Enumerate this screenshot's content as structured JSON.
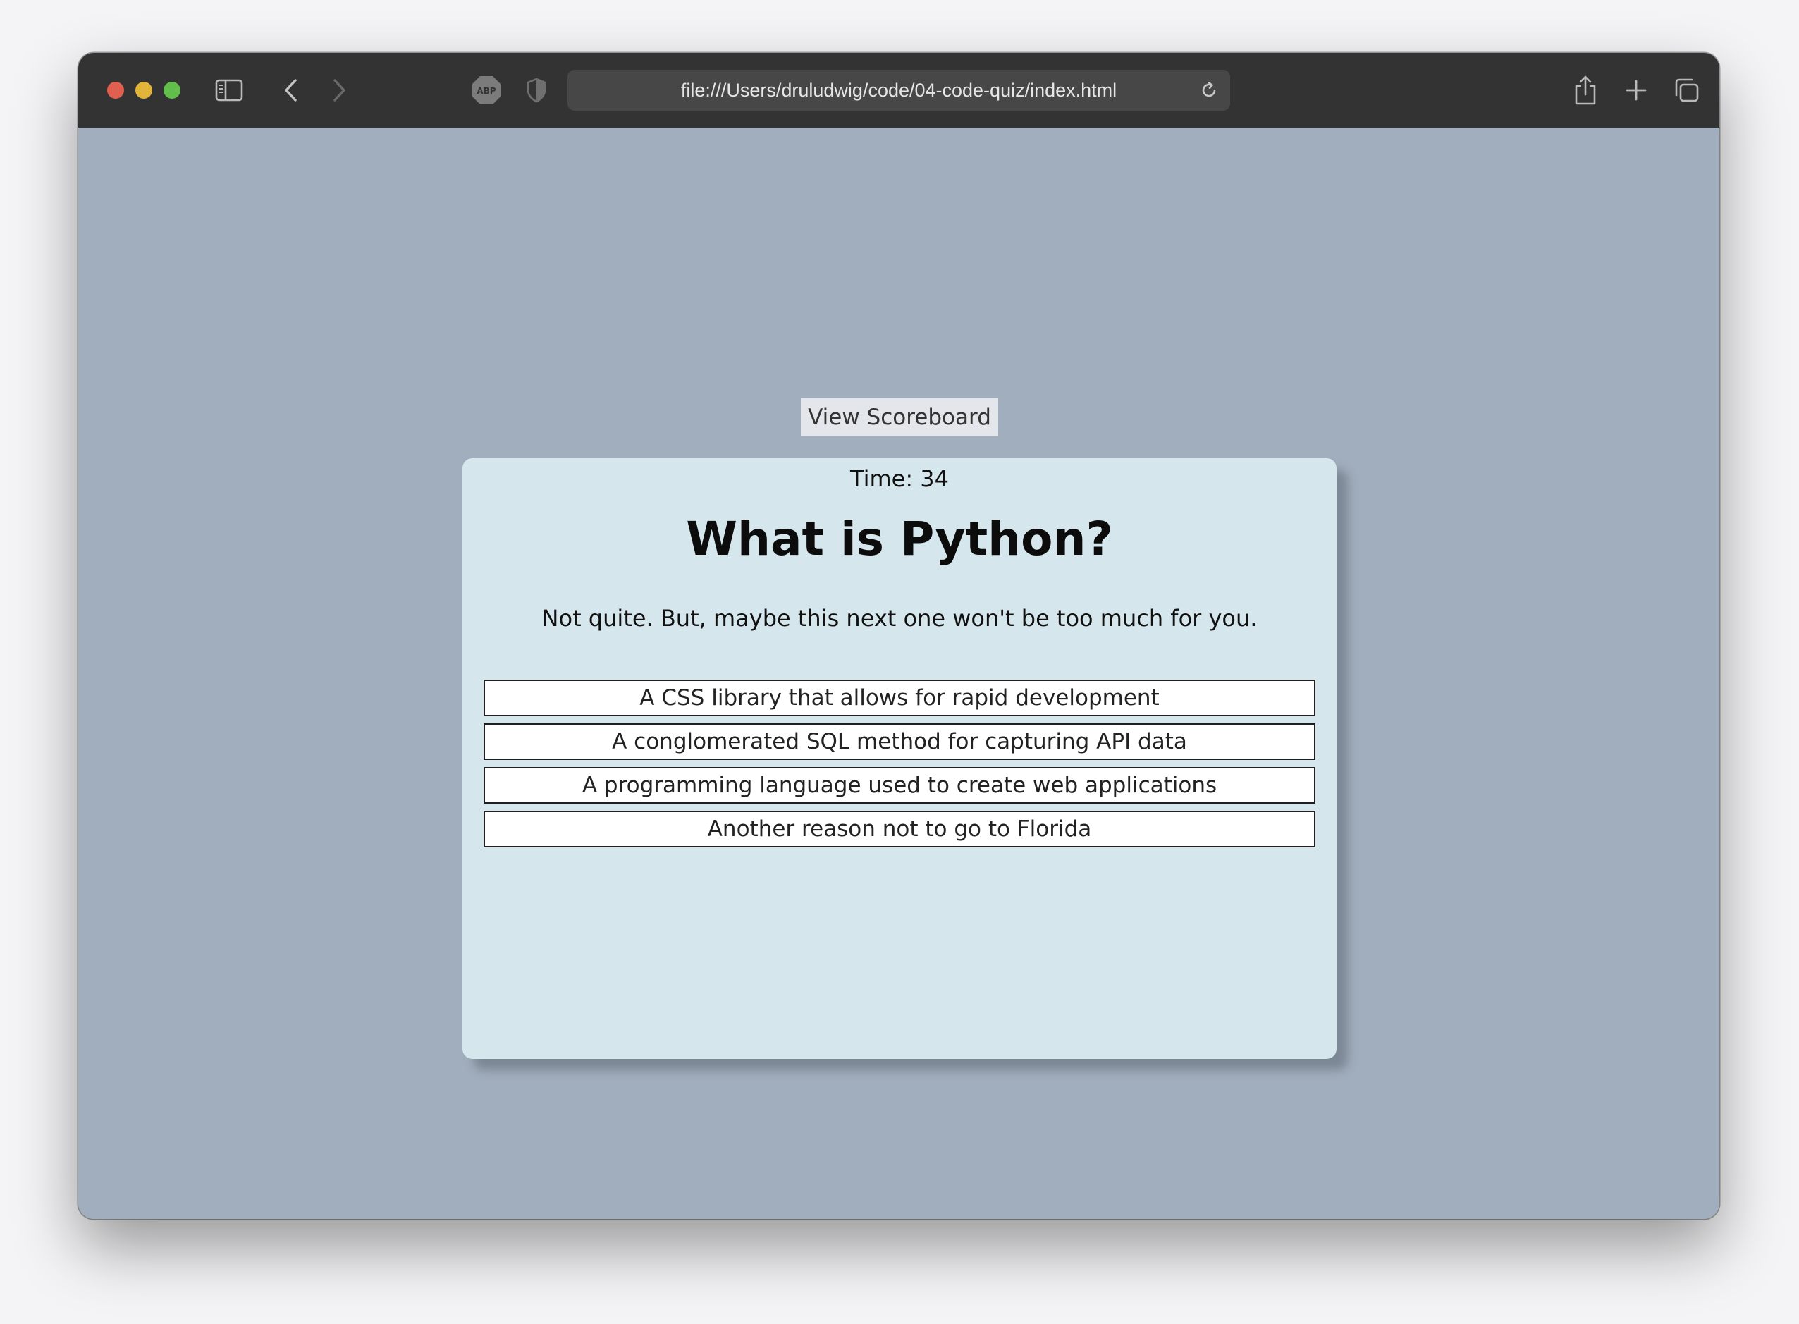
{
  "browser": {
    "url": "file:///Users/druludwig/code/04-code-quiz/index.html",
    "abp_label": "ABP"
  },
  "page": {
    "scoreboard_label": "View Scoreboard",
    "timer": "Time: 34",
    "question": "What is Python?",
    "feedback": "Not quite. But, maybe this next one won't be too much for you.",
    "answers": [
      "A CSS library that allows for rapid development",
      "A conglomerated SQL method for capturing API data",
      "A programming language used to create web applications",
      "Another reason not to go to Florida"
    ]
  },
  "colors": {
    "page_background": "#a1aebd",
    "card_background": "#d5e7ec",
    "toolbar_background": "#333333"
  }
}
